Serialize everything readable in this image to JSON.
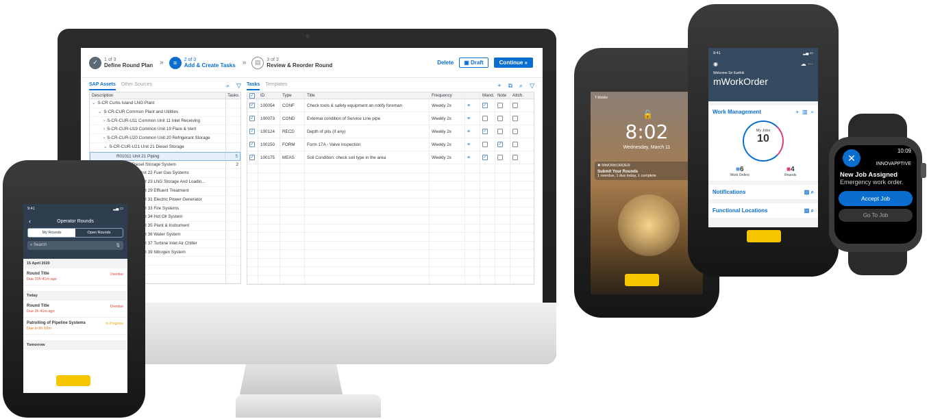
{
  "wizard": {
    "steps": [
      {
        "num": "1 of 3",
        "label": "Define Round Plan",
        "icon": "check-icon"
      },
      {
        "num": "2 of 3",
        "label": "Add & Create Tasks",
        "icon": "tasks-icon"
      },
      {
        "num": "3 of 3",
        "label": "Review & Reorder Round",
        "icon": "review-icon"
      }
    ],
    "delete": "Delete",
    "draft": "Draft",
    "continue": "Continue"
  },
  "assets": {
    "tab_active": "SAP Assets",
    "tab_inactive": "Other Sources",
    "col_description": "Description",
    "col_tasks": "Tasks",
    "rows": [
      {
        "text": "S-CR Curtis Island LNG Plant",
        "tasks": ""
      },
      {
        "text": "S-CR-CUR Common Plant and Utilities",
        "tasks": ""
      },
      {
        "text": "S-CR-CUR-U11 Common Unit 11 Inlet Receiving",
        "tasks": ""
      },
      {
        "text": "S-CR-CUR-U19 Common Unit 19 Flare & Vent",
        "tasks": ""
      },
      {
        "text": "S-CR-CUR-U20 Common Unit 20 Refrigerant Storage",
        "tasks": ""
      },
      {
        "text": "S-CR-CUR-U21 Unit 21 Diesel Storage",
        "tasks": ""
      },
      {
        "text": "R01011 Unit 21 Piping",
        "tasks": "5"
      },
      {
        "text": "R01010 Diesel Storage System",
        "tasks": "2"
      },
      {
        "text": "S-CR-CUR-U22 Unit 22 Fuel Gas Systems",
        "tasks": ""
      },
      {
        "text": "S-CR-CUR-U23 Unit 23 LNG Storage And Loadin...",
        "tasks": ""
      },
      {
        "text": "S-CR-CUR-U29 Unit 29 Effluent Treatment",
        "tasks": ""
      },
      {
        "text": "S-CR-CUR-U31 Unit 31 Electric Power Generator",
        "tasks": ""
      },
      {
        "text": "S-CR-CUR-U33 Unit 33 Fire Systems",
        "tasks": ""
      },
      {
        "text": "S-CR-CUR-U34 Unit 34 Hot Oil System",
        "tasks": ""
      },
      {
        "text": "S-CR-CUR-U35 Unit 35 Plant & Instrument",
        "tasks": ""
      },
      {
        "text": "S-CR-CUR-U36 Unit 36 Water System",
        "tasks": ""
      },
      {
        "text": "S-CR-CUR-U37 Unit 37 Turbine Inlet Air Chiller",
        "tasks": ""
      },
      {
        "text": "S-CR-CUR-U39 Unit 39 Nitrogen System",
        "tasks": ""
      }
    ]
  },
  "tasks": {
    "tab_active": "Tasks",
    "tab_inactive": "Templates",
    "headers": [
      "ID",
      "Type",
      "Title",
      "Frequency",
      "Mand.",
      "Note",
      "Attch."
    ],
    "rows": [
      {
        "id": "100054",
        "type": "CONF",
        "title": "Check tools & safety equipment an notify foreman",
        "freq": "Weekly 2x",
        "mand": true,
        "note": false,
        "attch": false
      },
      {
        "id": "100073",
        "type": "COND",
        "title": "External condition of Service Line pipe",
        "freq": "Weekly 2x",
        "mand": false,
        "note": false,
        "attch": false
      },
      {
        "id": "100124",
        "type": "RECD",
        "title": "Depth of pits (if any)",
        "freq": "Weekly 2x",
        "mand": true,
        "note": false,
        "attch": false
      },
      {
        "id": "100150",
        "type": "FORM",
        "title": "Form 17A - Valve Inspection",
        "freq": "Weekly 2x",
        "mand": false,
        "note": true,
        "attch": false
      },
      {
        "id": "100175",
        "type": "MEAS",
        "title": "Soil Condition: check soil type in the area",
        "freq": "Weekly 2x",
        "mand": true,
        "note": false,
        "attch": false
      }
    ]
  },
  "operator_rounds": {
    "time": "9:41",
    "title": "Operator Rounds",
    "seg_on": "My Rounds",
    "seg_off": "Open Rounds",
    "search": "Search",
    "sections": [
      {
        "label": "15 April 2020",
        "items": [
          {
            "title": "Round Title",
            "due": "Due 20h 41m ago",
            "status": "Overdue"
          }
        ]
      },
      {
        "label": "Today",
        "items": [
          {
            "title": "Round Title",
            "due": "Due 3h 41m ago",
            "status": "Overdue"
          },
          {
            "title": "Patrolling of Pipeline Systems",
            "due": "Due in 8h 10m",
            "status": "In Progress"
          }
        ]
      },
      {
        "label": "Tomorrow",
        "items": []
      }
    ]
  },
  "lockscreen": {
    "carrier": "T-Mobile",
    "time": "8:02",
    "date": "Wednesday, March 11",
    "app": "MWORKORDER",
    "notif_title": "Submit Your Rounds",
    "notif_body": "1 overdue, 1 due today, 1 complete"
  },
  "mworkorder": {
    "time": "9:41",
    "welcome": "Welcome Sri Karthik",
    "title": "mWorkOrder",
    "card_title": "Work Management",
    "ring_label": "My Jobs",
    "ring_value": "10",
    "stat1_value": "6",
    "stat1_label": "Work Orders",
    "stat2_value": "4",
    "stat2_label": "Rounds",
    "notifications": "Notifications",
    "functional": "Functional Locations"
  },
  "watch": {
    "time": "10:09",
    "brand": "INNOVAPPTIVE",
    "msg_title": "New Job Assigned",
    "msg_body": "Emergency work order.",
    "accept": "Accept Job",
    "goto": "Go To Job"
  }
}
